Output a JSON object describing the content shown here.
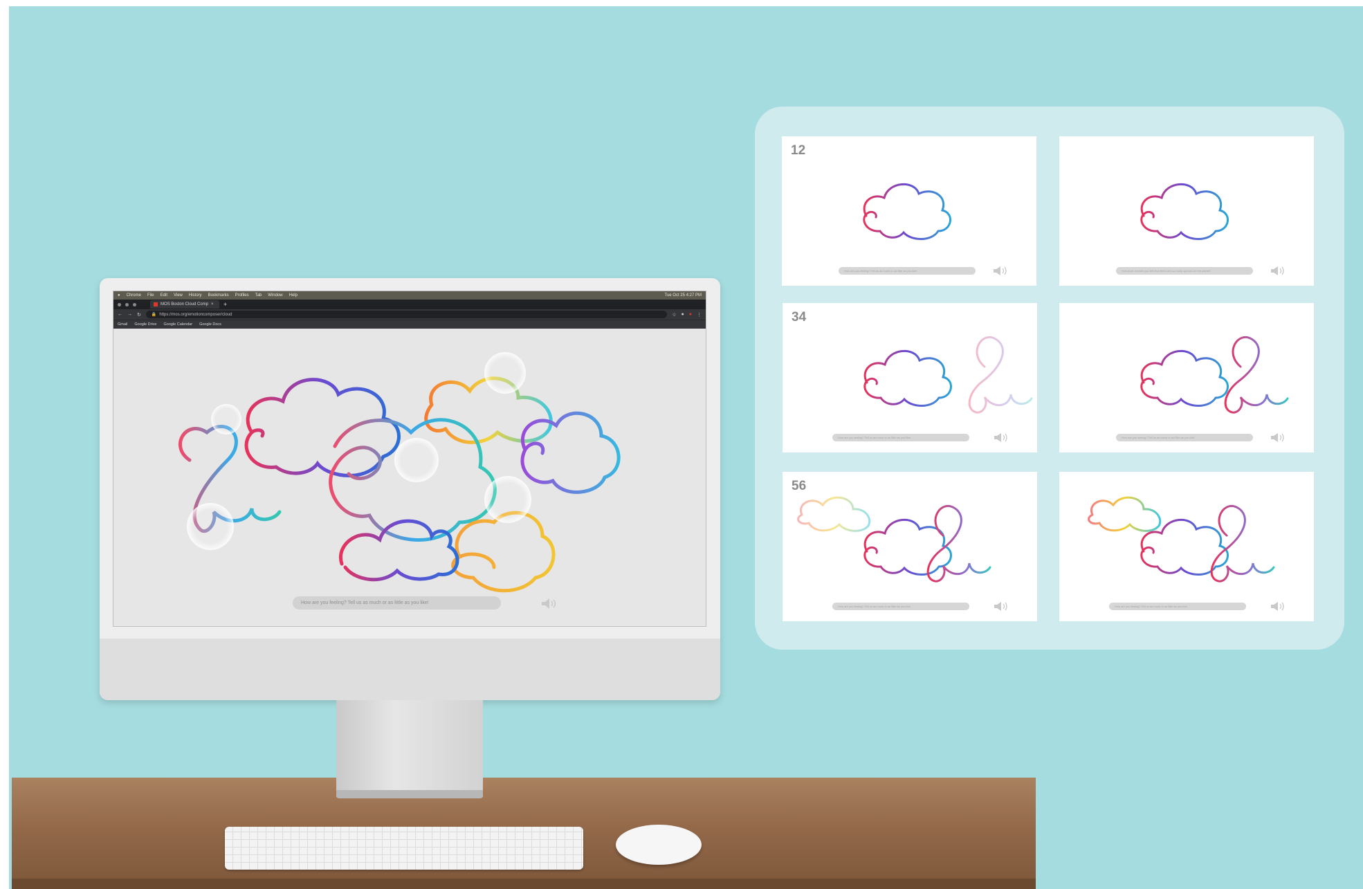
{
  "os_menubar": {
    "apple": "",
    "items": [
      "Chrome",
      "File",
      "Edit",
      "View",
      "History",
      "Bookmarks",
      "Profiles",
      "Tab",
      "Window",
      "Help"
    ],
    "clock": "Tue Oct 25 4:27 PM"
  },
  "browser": {
    "tab_title": "MOS Boston Cloud Comp",
    "new_tab": "+",
    "url": "https://mos.org/emotioncomposer/cloud",
    "bookmarks": [
      "Gmail",
      "Google Drive",
      "Google Calendar",
      "Google Docs"
    ]
  },
  "app": {
    "prompt_placeholder": "How are you feeling? Tell us as much or as little as you like!",
    "speaker_icon": "speaker-icon"
  },
  "storyboard": {
    "frames": [
      {
        "number": "12",
        "prompt": "How are you feeling? Tell us as much or as little as you like!"
      },
      {
        "number": "",
        "prompt": "How does it make you feel that there are so many species on the planet?"
      },
      {
        "number": "34",
        "prompt": "How are you feeling? Tell us as much or as little as you like!"
      },
      {
        "number": "",
        "prompt": "How are you feeling? Tell us as much or as little as you like!"
      },
      {
        "number": "56",
        "prompt": "How are you feeling? Tell us as much or as little as you like!"
      },
      {
        "number": "",
        "prompt": "How are you feeling? Tell us as much or as little as you like!"
      }
    ]
  },
  "colors": {
    "wall": "#a5dcdf",
    "panel": "#d0ebee",
    "desk": "#93694a"
  }
}
